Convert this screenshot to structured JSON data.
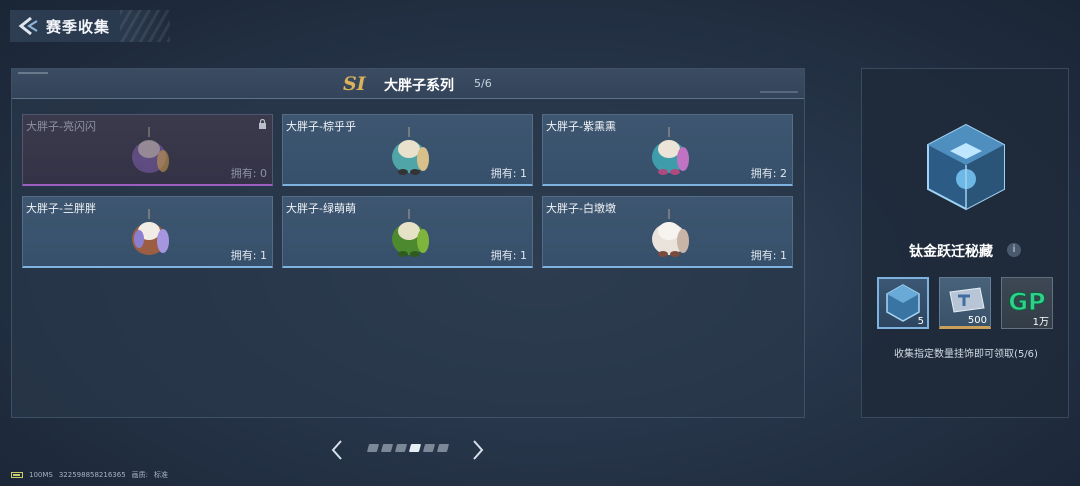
{
  "header": {
    "title": "赛季收集",
    "back_icon": "back-arrow-icon"
  },
  "series": {
    "badge": "SI",
    "name": "大胖子系列",
    "progress": "5/6"
  },
  "cards": [
    {
      "name": "大胖子-亮闪闪",
      "count": "拥有: 0",
      "locked": true,
      "color": "#7a5ea6"
    },
    {
      "name": "大胖子-棕乎乎",
      "count": "拥有: 1",
      "locked": false,
      "color": "#4fa5a8"
    },
    {
      "name": "大胖子-紫熏熏",
      "count": "拥有: 2",
      "locked": false,
      "color": "#b060a8"
    },
    {
      "name": "大胖子-兰胖胖",
      "count": "拥有: 1",
      "locked": false,
      "color": "#8d7fcf"
    },
    {
      "name": "大胖子-绿萌萌",
      "count": "拥有: 1",
      "locked": false,
      "color": "#5f9a3b"
    },
    {
      "name": "大胖子-白墩墩",
      "count": "拥有: 1",
      "locked": false,
      "color": "#e9e3dc"
    }
  ],
  "pager": {
    "total": 6,
    "active": 3
  },
  "reward": {
    "name": "钛金跃迁秘藏",
    "info": "i",
    "hint": "收集指定数量挂饰即可领取(5/6)",
    "items": [
      {
        "qty": "5",
        "icon": "chest-icon"
      },
      {
        "qty": "500",
        "icon": "ticket-icon"
      },
      {
        "qty": "1万",
        "icon": "gp-icon",
        "label": "GP"
      }
    ]
  },
  "status": {
    "ping": "100MS",
    "uid": "322598858216365",
    "quality_label": "画质:",
    "quality": "标准"
  },
  "colors": {
    "accent_blue": "#7fb3df",
    "locked_purple": "#9c5fbf",
    "gold": "#d9b25a"
  }
}
